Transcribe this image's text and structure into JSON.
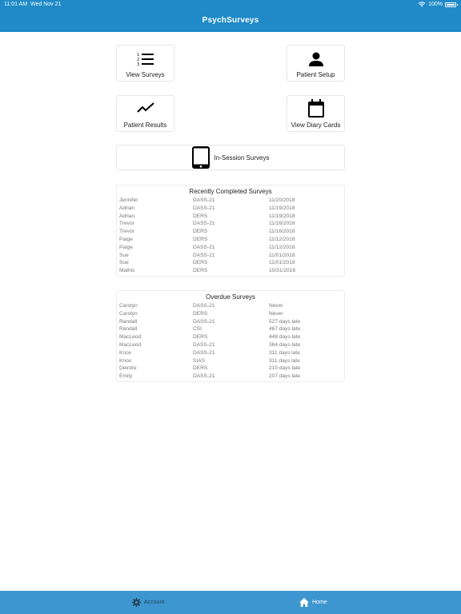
{
  "status": {
    "time": "11:01 AM",
    "date": "Wed Nov 21",
    "battery": "100%"
  },
  "header": {
    "title": "PsychSurveys"
  },
  "tiles": {
    "view_surveys": "View Surveys",
    "patient_setup": "Patient Setup",
    "patient_results": "Patient Results",
    "view_diary_cards": "View Diary Cards",
    "in_session": "In-Session Surveys"
  },
  "recent": {
    "title": "Recently Completed Surveys",
    "rows": [
      [
        "Jennifer",
        "DASS-21",
        "11/20/2018"
      ],
      [
        "Adrian",
        "DASS-21",
        "11/19/2018"
      ],
      [
        "Adrian",
        "DERS",
        "11/19/2018"
      ],
      [
        "Trevor",
        "DASS-21",
        "11/16/2018"
      ],
      [
        "Trevor",
        "DERS",
        "11/16/2018"
      ],
      [
        "Paige",
        "DERS",
        "11/12/2018"
      ],
      [
        "Paige",
        "DASS-21",
        "11/12/2018"
      ],
      [
        "Sue",
        "DASS-21",
        "11/01/2018"
      ],
      [
        "Sue",
        "DERS",
        "11/01/2018"
      ],
      [
        "Mathis",
        "DERS",
        "10/31/2018"
      ]
    ]
  },
  "overdue": {
    "title": "Overdue Surveys",
    "rows": [
      [
        "Carolyn",
        "DASS-21",
        "Never"
      ],
      [
        "Carolyn",
        "DERS",
        "Never"
      ],
      [
        "Randall",
        "DASS-21",
        "527 days late"
      ],
      [
        "Randall",
        "CSI",
        "467 days late"
      ],
      [
        "MacLeod",
        "DERS",
        "448 days late"
      ],
      [
        "MacLeod",
        "DASS-21",
        "364 days late"
      ],
      [
        "Knox",
        "DASS-21",
        "311 days late"
      ],
      [
        "Knox",
        "SIAS",
        "311 days late"
      ],
      [
        "Deirdre",
        "DERS",
        "210 days late"
      ],
      [
        "Emily",
        "DASS-21",
        "207 days late"
      ]
    ]
  },
  "tabbar": {
    "account": "Account",
    "home": "Home"
  },
  "icons": {
    "view_surveys": "numbered-list-icon",
    "patient_setup": "person-icon",
    "patient_results": "trending-line-icon",
    "view_diary_cards": "calendar-icon",
    "in_session": "tablet-icon",
    "account": "gear-icon",
    "home": "home-icon"
  },
  "colors": {
    "header": "#1f8ac7",
    "tabbar": "#3d96cf",
    "tab_inactive": "#24445e",
    "tab_active": "#ffffff"
  }
}
